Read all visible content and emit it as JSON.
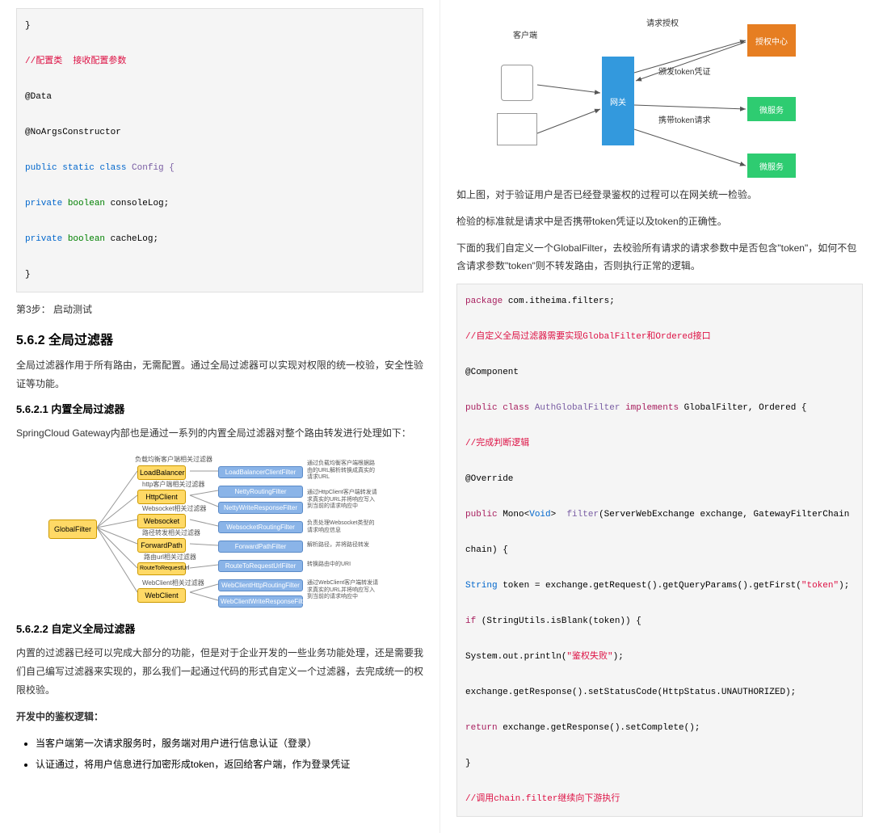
{
  "left": {
    "code1_parts": {
      "brace1": "}",
      "cm1": "//配置类  接收配置参数",
      "data": "@Data",
      "noargs": "@NoArgsConstructor",
      "pub": "public",
      "stat": "static",
      "cls": "class",
      "cfg": " Config {",
      "priv": "private",
      "bool": "boolean",
      "f1": " consoleLog;",
      "f2": " cacheLog;",
      "brace2": "}"
    },
    "step": "第3步：  启动测试",
    "h562": "5.6.2 全局过滤器",
    "p1": "全局过滤器作用于所有路由，无需配置。通过全局过滤器可以实现对权限的统一校验，安全性验证等功能。",
    "h5621": "5.6.2.1 内置全局过滤器",
    "p2": "SpringCloud Gateway内部也是通过一系列的内置全局过滤器对整个路由转发进行处理如下：",
    "diag1": {
      "root": "GlobalFilter",
      "l2_lbl": [
        "负载均衡客户端相关过滤器",
        "http客户端相关过滤器",
        "Websocket相关过滤器",
        "路径转发相关过滤器",
        "路由url相关过滤器",
        "WebClient相关过滤器"
      ],
      "l2": [
        "LoadBalancer",
        "HttpClient",
        "Websocket",
        "ForwardPath",
        "RouteToRequestUrl",
        "WebClient"
      ],
      "l3": [
        "LoadBalancerClientFilter",
        "NettyRoutingFilter",
        "NettyWriteResponseFilter",
        "WebsocketRoutingFilter",
        "ForwardPathFilter",
        "RouteToRequestUrlFilter",
        "WebClientHttpRoutingFilter",
        "WebClientWriteResponseFilter"
      ],
      "desc": [
        "通过负载均衡客户端根据路由的URL解析转换成真实的请求URL",
        "通过HttpClient客户端转发请求真实的URL并将响应写入到当前的请求响应中",
        "负责处理Websocket类型的请求响应信息",
        "解析路径，并将路径转发",
        "转换路由中的URI",
        "通过WebClient客户端转发请求真实的URL并将响应写入到当前的请求响应中"
      ]
    },
    "h5622": "5.6.2.2 自定义全局过滤器",
    "p3": "内置的过滤器已经可以完成大部分的功能，但是对于企业开发的一些业务功能处理，还是需要我们自己编写过滤器来实现的，那么我们一起通过代码的形式自定义一个过滤器，去完成统一的权限校验。",
    "devh": "开发中的鉴权逻辑：",
    "li1": "当客户端第一次请求服务时，服务端对用户进行信息认证（登录）",
    "li2": "认证通过，将用户信息进行加密形成token，返回给客户端，作为登录凭证"
  },
  "right": {
    "diag2": {
      "client": "客户端",
      "gw": "网关",
      "auth": "授权中心",
      "svc": "微服务",
      "req_auth": "请求授权",
      "issue": "颁发token凭证",
      "carry": "携带token请求"
    },
    "p1": "如上图，对于验证用户是否已经登录鉴权的过程可以在网关统一检验。",
    "p2": "检验的标准就是请求中是否携带token凭证以及token的正确性。",
    "p3": "下面的我们自定义一个GlobalFilter，去校验所有请求的请求参数中是否包含\"token\"，如何不包含请求参数\"token\"则不转发路由，否则执行正常的逻辑。",
    "code": {
      "pkg_kw": "package",
      "pkg_v": " com.itheima.filters;",
      "cm1a": "//自定义全局过滤器需要实现",
      "cm1b": "GlobalFilter",
      "cm1c": "和",
      "cm1d": "Ordered",
      "cm1e": "接口",
      "comp": "@Component",
      "pub": "public",
      "cls": "class",
      "name": " AuthGlobalFilter",
      "impl": "implements",
      "ifs": " GlobalFilter, Ordered {",
      "cm2": "//完成判断逻辑",
      "over": "@Override",
      "mono": " Mono",
      "void": "Void",
      "gt": ">",
      "fltr": "  filter",
      "args": "(ServerWebExchange exchange, GatewayFilterChain",
      "chain": "chain) {",
      "str_t": "String",
      "tok_a": " token = exchange.getRequest().getQueryParams().getFirst(",
      "tok_s": "\"token\"",
      "end": ");",
      "if": "if",
      "if_a": " (StringUtils.isBlank(token)) {",
      "sysout": "System.out.println(",
      "fail": "\"鉴权失败\"",
      "setst": "exchange.getResponse().setStatusCode(HttpStatus.UNAUTHORIZED);",
      "ret": "return",
      "sc": " exchange.getResponse().setComplete();",
      "brace": "}",
      "cm3": "//调用chain.filter继续向下游执行"
    }
  }
}
